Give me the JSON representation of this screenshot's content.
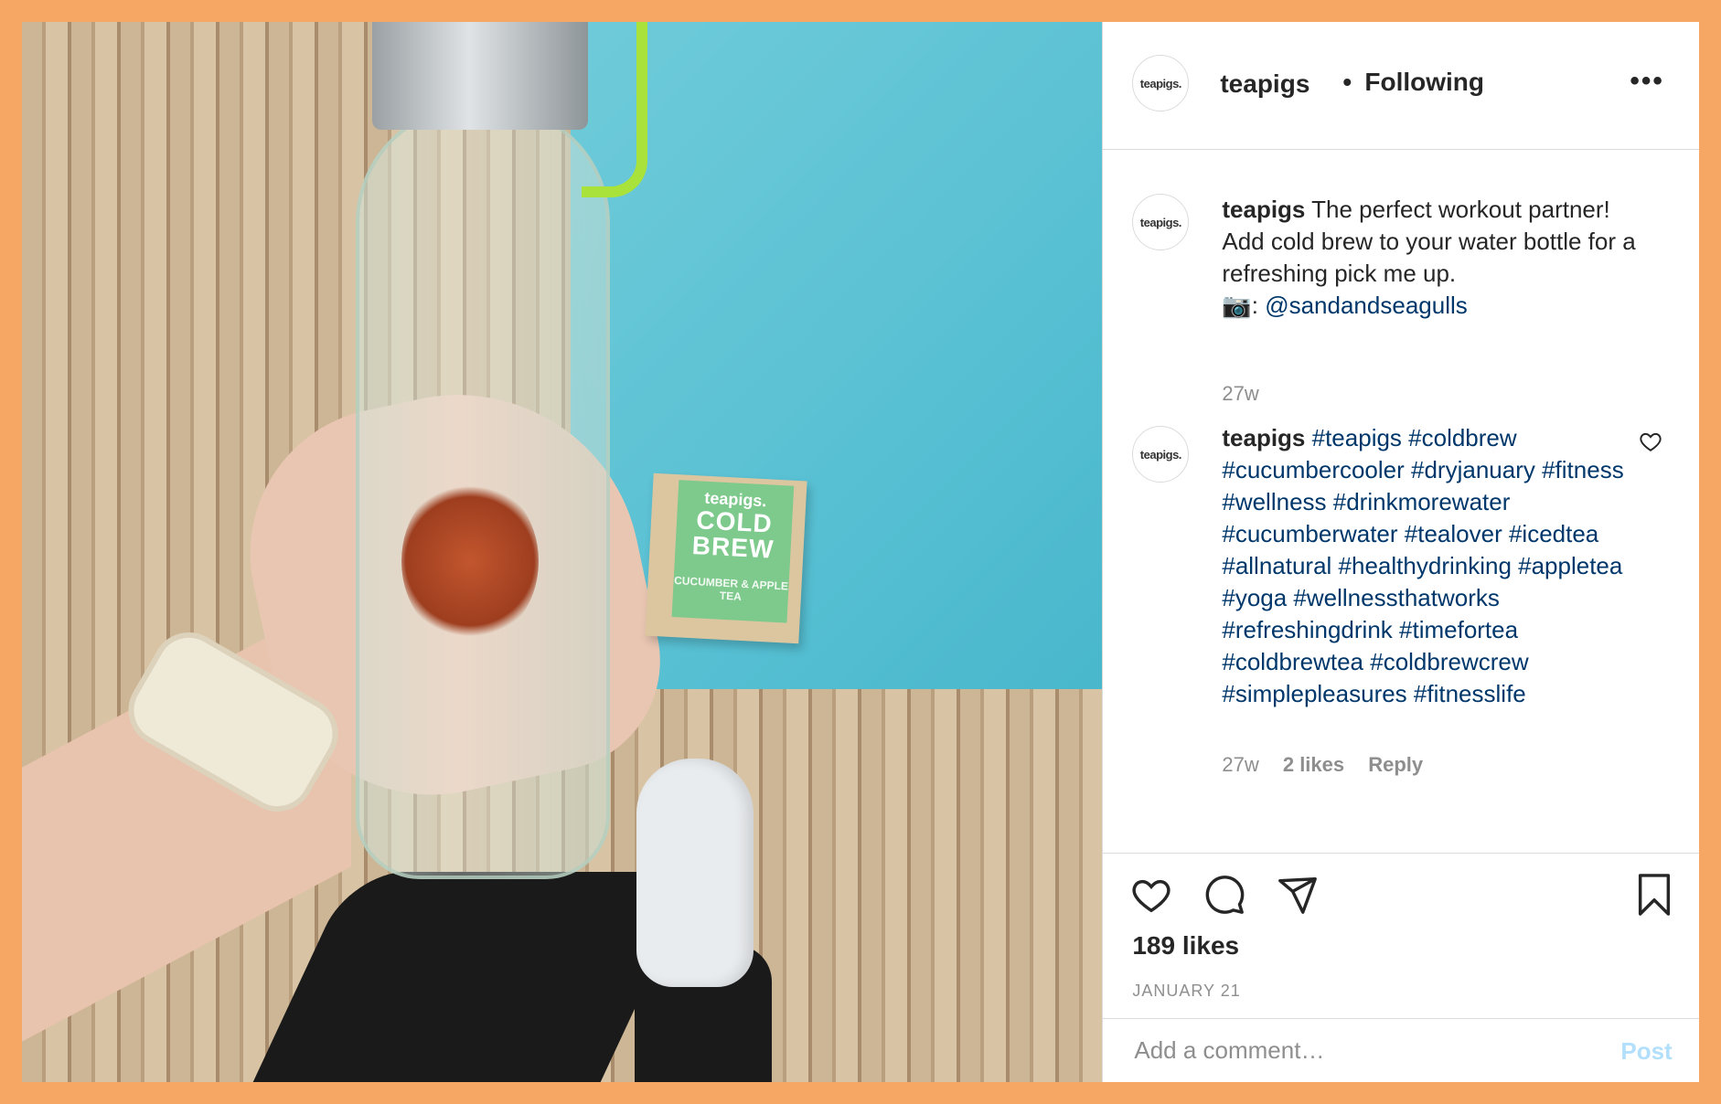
{
  "header": {
    "avatar_text": "teapigs.",
    "username": "teapigs",
    "separator": "•",
    "follow_status": "Following",
    "more_label": "•••"
  },
  "photo": {
    "box_brand": "teapigs.",
    "box_line1": "COLD",
    "box_line2": "BREW",
    "box_sub": "CUCUMBER & APPLE TEA"
  },
  "caption": {
    "avatar_text": "teapigs.",
    "username": "teapigs",
    "text": "The perfect workout partner! Add cold brew to your water bottle for a refreshing pick me up.",
    "camera_emoji": "📷",
    "colon": ":",
    "mention": "@sandandseagulls",
    "time": "27w"
  },
  "hashtag_comment": {
    "avatar_text": "teapigs.",
    "username": "teapigs",
    "tags": "#teapigs #coldbrew #cucumbercooler #dryjanuary #fitness #wellness #drinkmorewater #cucumberwater #tealover #icedtea #allnatural #healthydrinking #appletea #yoga #wellnessthatworks #refreshingdrink #timefortea #coldbrewtea #coldbrewcrew #simplepleasures #fitnesslife",
    "time": "27w",
    "likes": "2 likes",
    "reply": "Reply"
  },
  "post": {
    "likes": "189 likes",
    "date": "JANUARY 21"
  },
  "comment_box": {
    "placeholder": "Add a comment…",
    "post_label": "Post"
  },
  "colors": {
    "border_frame": "#F6A763",
    "link": "#00376b",
    "post_disabled": "#b2dffc"
  }
}
